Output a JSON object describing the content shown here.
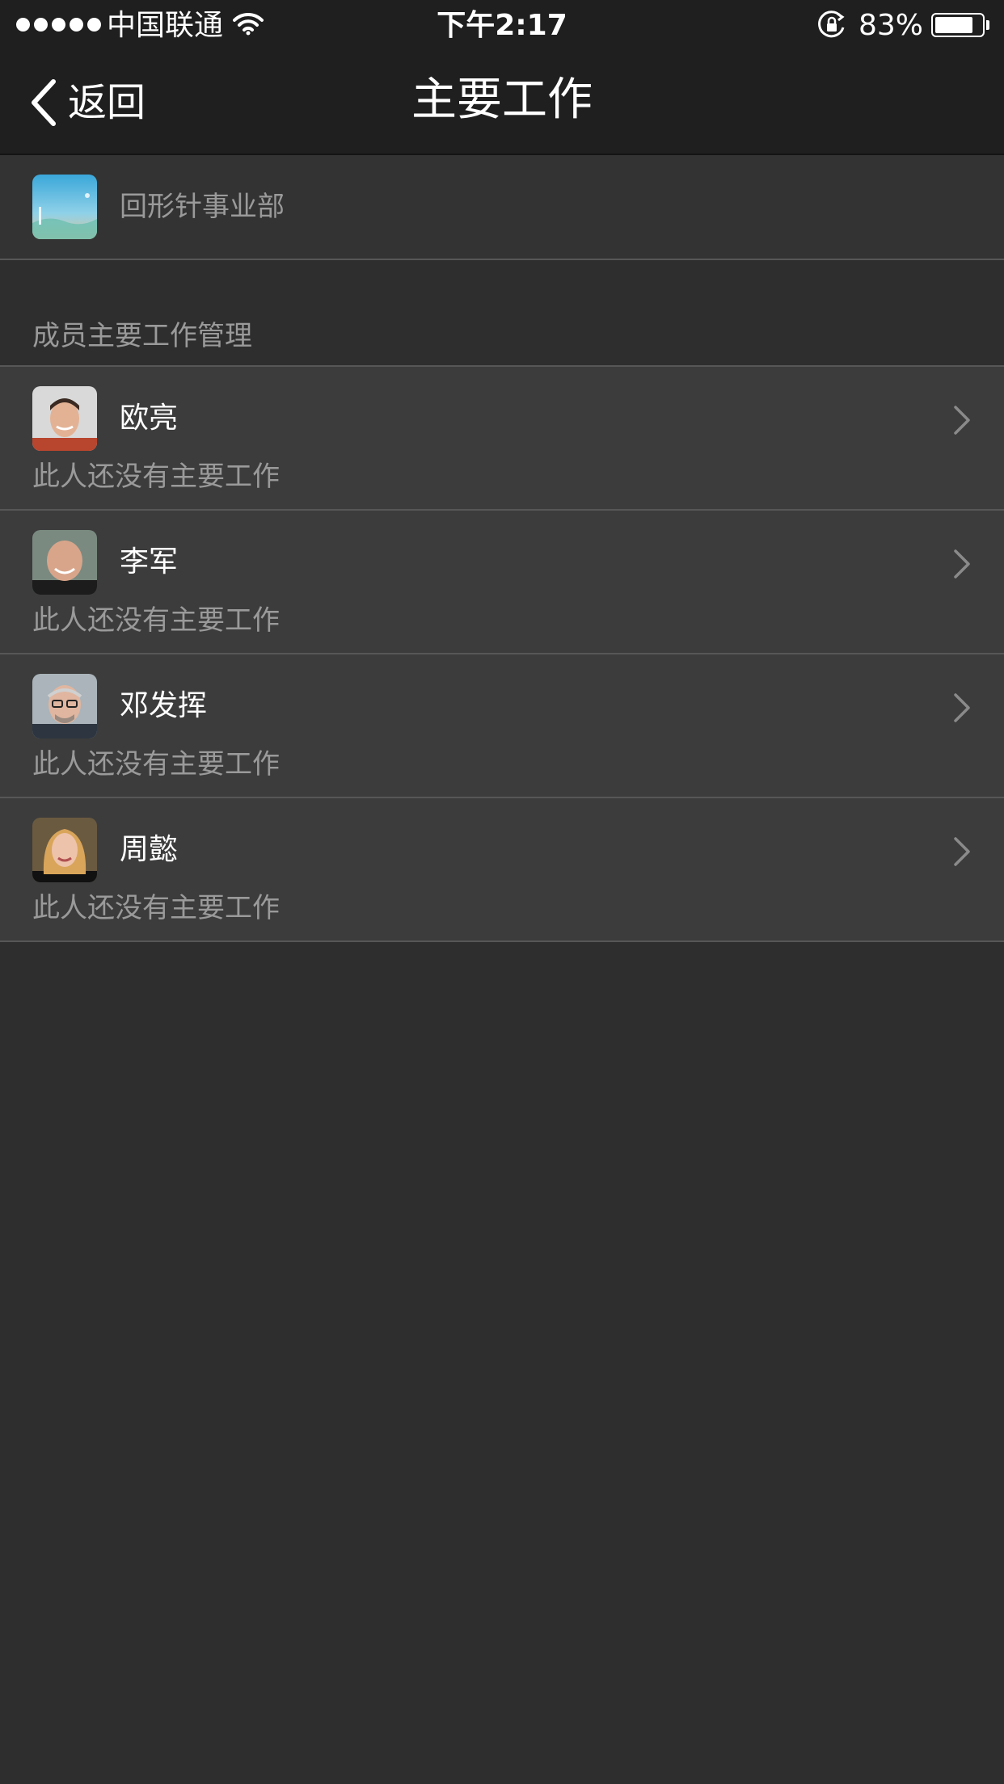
{
  "status_bar": {
    "carrier": "中国联通",
    "time": "下午2:17",
    "battery_percent": "83%",
    "battery_level": 0.83,
    "signal_dots": 5
  },
  "nav": {
    "back_label": "返回",
    "title": "主要工作"
  },
  "department": {
    "name": "回形针事业部"
  },
  "section": {
    "header": "成员主要工作管理"
  },
  "members": [
    {
      "name": "欧亮",
      "subtitle": "此人还没有主要工作"
    },
    {
      "name": "李军",
      "subtitle": "此人还没有主要工作"
    },
    {
      "name": "邓发挥",
      "subtitle": "此人还没有主要工作"
    },
    {
      "name": "周懿",
      "subtitle": "此人还没有主要工作"
    }
  ],
  "icons": {
    "wifi": "wifi-icon",
    "lock": "rotation-lock-icon",
    "back": "chevron-left-icon",
    "row_arrow": "chevron-right-icon"
  },
  "colors": {
    "nav_background": "#1f1f1f",
    "page_background": "#2e2e2e",
    "row_background": "#3c3c3c",
    "secondary_text": "#9a9a9a",
    "separator": "#575757"
  }
}
